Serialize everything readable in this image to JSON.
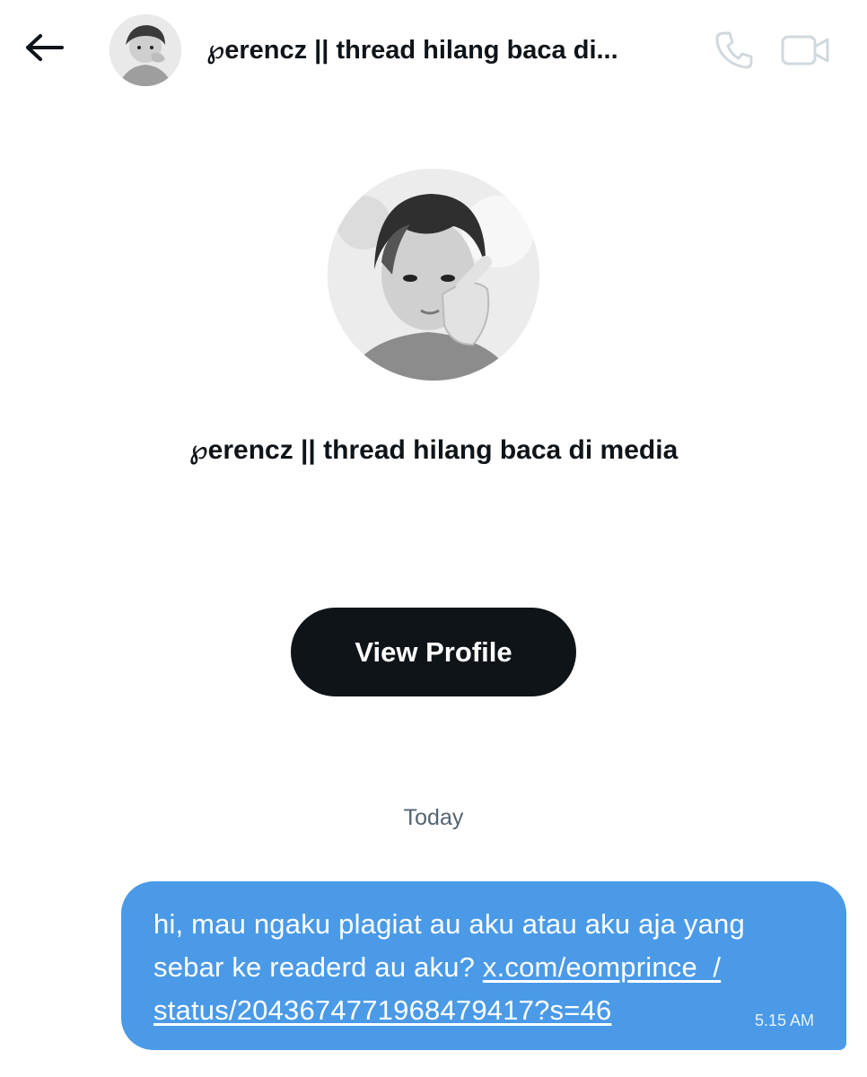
{
  "header": {
    "title": "℘erencz || thread hilang baca di...",
    "back_icon": "arrow-left-icon",
    "call_icon": "phone-icon",
    "video_icon": "video-camera-icon"
  },
  "profile": {
    "name": "℘erencz || thread hilang baca di media",
    "view_profile_label": "View Profile"
  },
  "conversation": {
    "date_separator": "Today",
    "messages": [
      {
        "text_before_link": "hi, mau ngaku plagiat au aku atau aku aja yang sebar ke readerd au aku? ",
        "link_line_1": "x.com/eomprince_/",
        "link_line_2": "status/2043674771968479417?s=46",
        "time": "5.15 AM",
        "bubble_color": "#4a9ae8"
      }
    ]
  },
  "colors": {
    "button_bg": "#0f1419",
    "muted_text": "#536471",
    "disabled_icon": "#cfd9de"
  }
}
